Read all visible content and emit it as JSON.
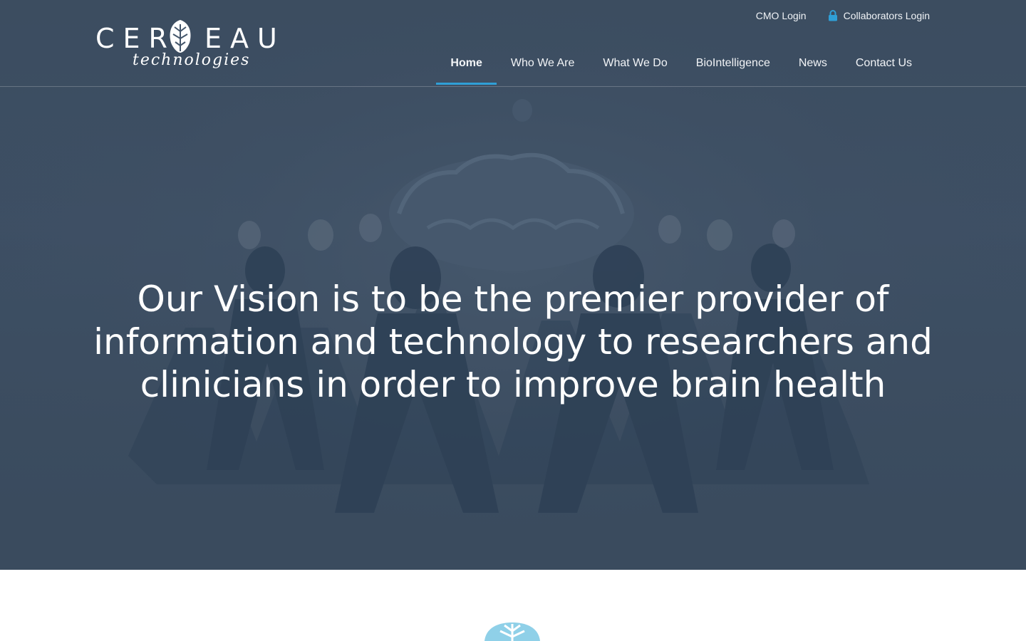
{
  "brand": {
    "name": "CEREBEAU",
    "name_left": "CER",
    "name_right": "EAU",
    "tagline": "technologies"
  },
  "utility": {
    "cmo_login": "CMO Login",
    "collaborators_login": "Collaborators Login"
  },
  "nav": {
    "items": [
      {
        "label": "Home",
        "active": true
      },
      {
        "label": "Who We Are",
        "active": false
      },
      {
        "label": "What We Do",
        "active": false
      },
      {
        "label": "BioIntelligence",
        "active": false
      },
      {
        "label": "News",
        "active": false
      },
      {
        "label": "Contact Us",
        "active": false
      }
    ]
  },
  "hero": {
    "headline_line1": "Our Vision is to be the premier provider of",
    "headline_line2": "information and technology to researchers and",
    "headline_line3": "clinicians in order to improve brain health"
  },
  "colors": {
    "accent": "#2f9fd6",
    "hero_overlay": "#3e5065",
    "brain_icon": "#8fd0e8"
  }
}
